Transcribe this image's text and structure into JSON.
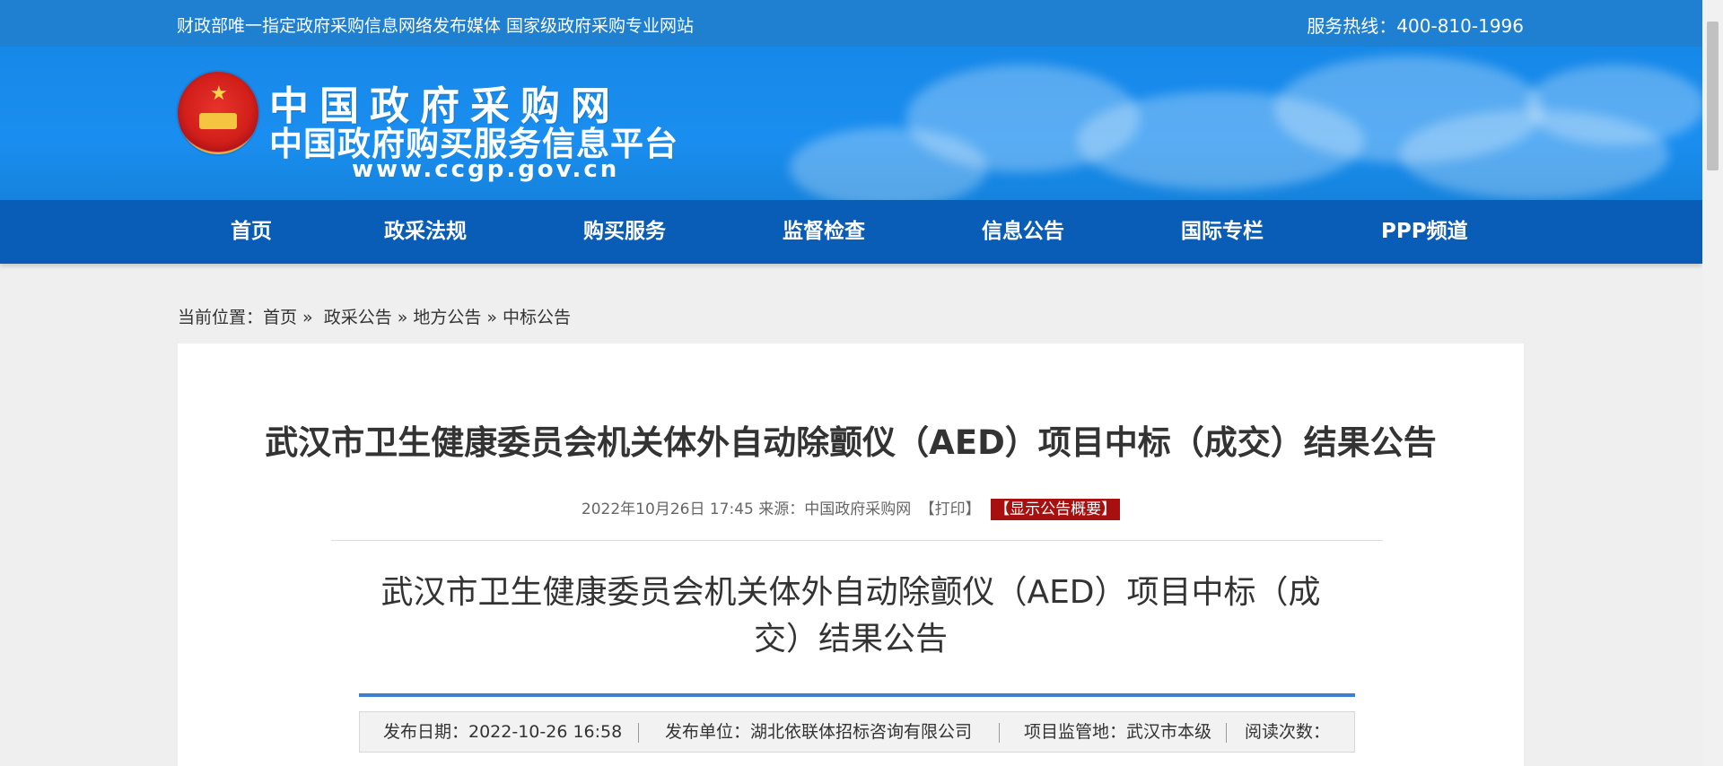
{
  "topbar": {
    "slogan": "财政部唯一指定政府采购信息网络发布媒体 国家级政府采购专业网站",
    "hotline": "服务热线：400-810-1996"
  },
  "header": {
    "logo_title": "中国政府采购网",
    "logo_subtitle": "中国政府购买服务信息平台",
    "logo_url": "www.ccgp.gov.cn",
    "emblem_icon": "national-emblem-icon"
  },
  "nav": {
    "items": [
      {
        "label": "首页"
      },
      {
        "label": "政采法规"
      },
      {
        "label": "购买服务"
      },
      {
        "label": "监督检查"
      },
      {
        "label": "信息公告"
      },
      {
        "label": "国际专栏"
      },
      {
        "label": "PPP频道"
      }
    ]
  },
  "breadcrumb": {
    "prefix": "当前位置：",
    "items": [
      "首页",
      "政采公告",
      "地方公告",
      "中标公告"
    ],
    "separator": "»"
  },
  "article": {
    "title": "武汉市卫生健康委员会机关体外自动除颤仪（AED）项目中标（成交）结果公告",
    "meta_datetime": "2022年10月26日 17:45",
    "meta_source": "来源：中国政府采购网",
    "print_label": "【打印】",
    "summary_label": "【显示公告概要】",
    "sub_title": "武汉市卫生健康委员会机关体外自动除颤仪（AED）项目中标（成交）结果公告",
    "info": {
      "publish_date": "发布日期：2022-10-26 16:58",
      "publisher": "发布单位：湖北依联体招标咨询有限公司",
      "region": "项目监管地：武汉市本级",
      "reads": "阅读次数："
    }
  },
  "colors": {
    "topbar": "#1f7fd0",
    "nav": "#0a5db7",
    "accent_red": "#a80f0f",
    "rule_blue": "#3a7fd0"
  }
}
